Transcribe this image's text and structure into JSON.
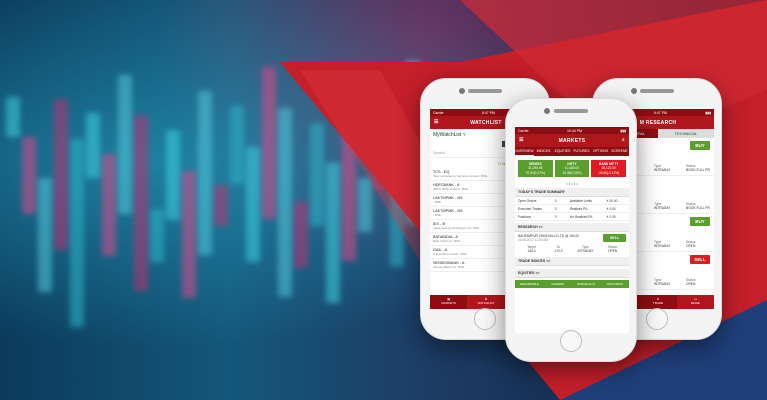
{
  "colors": {
    "brand_red": "#b0171d",
    "dark_red": "#8e0d12",
    "buy_green": "#5a9e2c",
    "sell_red": "#e01b22"
  },
  "left_phone": {
    "status": {
      "carrier": "Carrier",
      "time": "6:47 PM"
    },
    "title": "WATCHLIST",
    "watchlist_name": "MyWatchList",
    "segment_tabs": [
      "EQUITY",
      "COM"
    ],
    "symbol_header": "Symbol",
    "summary": {
      "value": "0.11",
      "label": "Gain"
    },
    "items": [
      {
        "sym": "TCS - EQ",
        "name": "Tata Consultancy Services Limited : BSE"
      },
      {
        "sym": "HDFCBANK - A",
        "name": "HDFC Bank Limited : BSE"
      },
      {
        "sym": "LAKTMPMK - NS",
        "name": "- BSE"
      },
      {
        "sym": "LAKTMPMK - NS",
        "name": "- BSE"
      },
      {
        "sym": "IEX - B",
        "name": "Indian Energy Exchange Ltd : BSE"
      },
      {
        "sym": "BATAINDIA - A",
        "name": "Bata India Ltd : BSE"
      },
      {
        "sym": "GAIL - A",
        "name": "Gail (India) Limited : BSE"
      },
      {
        "sym": "SENSEXBANK - A",
        "name": "Sensex Bank Ltd : BSE"
      }
    ],
    "nav": [
      "MARKETS",
      "WATCHLIST",
      "TRADE"
    ]
  },
  "center_phone": {
    "status": {
      "carrier": "Carrier",
      "time": "10:44 PM"
    },
    "title": "MARKETS",
    "tabs": [
      "OVERVIEW",
      "INDICES",
      "EQUITIES",
      "FUTURES",
      "OPTIONS",
      "SCREENE"
    ],
    "indices": [
      {
        "name": "SENSEX",
        "value": "31,093.96",
        "change": "97.64(0.27%)",
        "color": "#5a9e2c"
      },
      {
        "name": "NIFTY",
        "value": "10,180.00",
        "change": "25.35(0.25%)",
        "color": "#5a9e2c"
      },
      {
        "name": "BANK NIFTY",
        "value": "25,120.00",
        "change": "-35.85(-0.12%)",
        "color": "#e01b22"
      }
    ],
    "dots": "• • • • •",
    "trade_summary_title": "TODAY'S TRADE SUMMARY",
    "trade_summary": [
      [
        "Open Orders",
        "0",
        "Available Limits",
        "₹ 00.00"
      ],
      [
        "Executed Trades",
        "0",
        "Realized P/L",
        "₹ 0.00"
      ],
      [
        "Positions",
        "0",
        "Un-Realized P/L",
        "₹ 0.00"
      ]
    ],
    "research_title": "RESEARCH",
    "research_arrow": ">>",
    "research_item": {
      "text": "BALRAMPUR CHINI MILLS LTD @ 154.00",
      "date": "22.06.2017 11:32 AM",
      "action": "SELL"
    },
    "research_cols": [
      {
        "label": "Target",
        "value": "146.0"
      },
      {
        "label": "SL",
        "value": "170.0"
      },
      {
        "label": "Type",
        "value": "INTRADAY"
      },
      {
        "label": "Status",
        "value": "OPEN"
      }
    ],
    "trade_indices": "TRADE INDICES",
    "trade_indices_arrow": ">>",
    "equities": "EQUITIES",
    "equities_arrow": ">>",
    "equity_tabs": [
      "REMARKABLE",
      "GAINERS",
      "BAHUBAHUS",
      "TOPLOSERS"
    ]
  },
  "right_phone": {
    "status": {
      "carrier": "Carrier",
      "time": "6:47 PM"
    },
    "title": "M RESEARCH",
    "tabs": [
      "FUNDAMENTAL",
      "TECHNICAL"
    ],
    "cards": [
      {
        "action": "BUY",
        "type": "INTRADAY",
        "status": "BOOK FULL PR"
      },
      {
        "action": "",
        "type": "INTRADAY",
        "status": "BOOK FULL PR"
      },
      {
        "action": "BUY",
        "type": "INTRADAY",
        "status": "OPEN"
      },
      {
        "action": "SELL",
        "type": "INTRADAY",
        "status": "OPEN"
      }
    ],
    "type_label": "Type",
    "status_label": "Status",
    "nav": [
      "TRADE",
      "MORE"
    ]
  }
}
